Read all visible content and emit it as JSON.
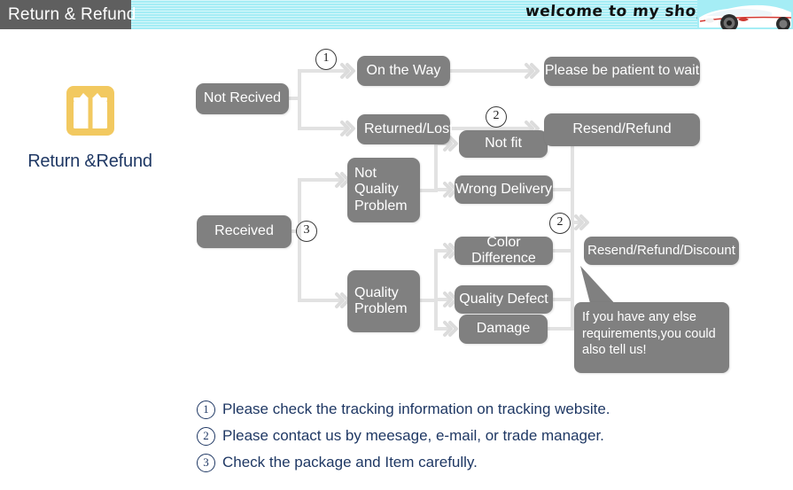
{
  "header": {
    "tab_label": "Return & Refund",
    "welcome_text": "welcome to my shop",
    "banner_color": "#a5edf5",
    "tab_color": "#5f5f5f",
    "car_icon": "sports-car-icon"
  },
  "brand": {
    "icon": "gift-box-icon",
    "icon_color": "#f2c960",
    "label": "Return &Refund",
    "label_color": "#1f3864"
  },
  "flow": {
    "node_color": "#808080",
    "connector_color": "#e2e2e2",
    "nodes": {
      "not_received": "Not Recived",
      "on_the_way": "On the Way",
      "returned_lost": "Returned/Lost",
      "please_wait": "Please be patient to wait",
      "resend_refund": "Resend/Refund",
      "received": "Received",
      "not_quality_problem": "Not\nQuality\nProblem",
      "quality_problem": "Quality\nProblem",
      "not_fit": "Not fit",
      "wrong_delivery": "Wrong Delivery",
      "color_difference": "Color Difference",
      "quality_defect": "Quality Defect",
      "damage": "Damage",
      "resend_refund_discount": "Resend/Refund/Discount"
    },
    "markers": {
      "marker_1": "1",
      "marker_2a": "2",
      "marker_3": "3",
      "marker_2b": "2"
    },
    "callout": "If you have any else requirements,you could also tell us!"
  },
  "footnotes": [
    {
      "num": "1",
      "text": "Please check the tracking information on tracking website."
    },
    {
      "num": "2",
      "text": "Please contact us by meesage, e-mail, or trade manager."
    },
    {
      "num": "3",
      "text": "Check the package and Item carefully."
    }
  ]
}
